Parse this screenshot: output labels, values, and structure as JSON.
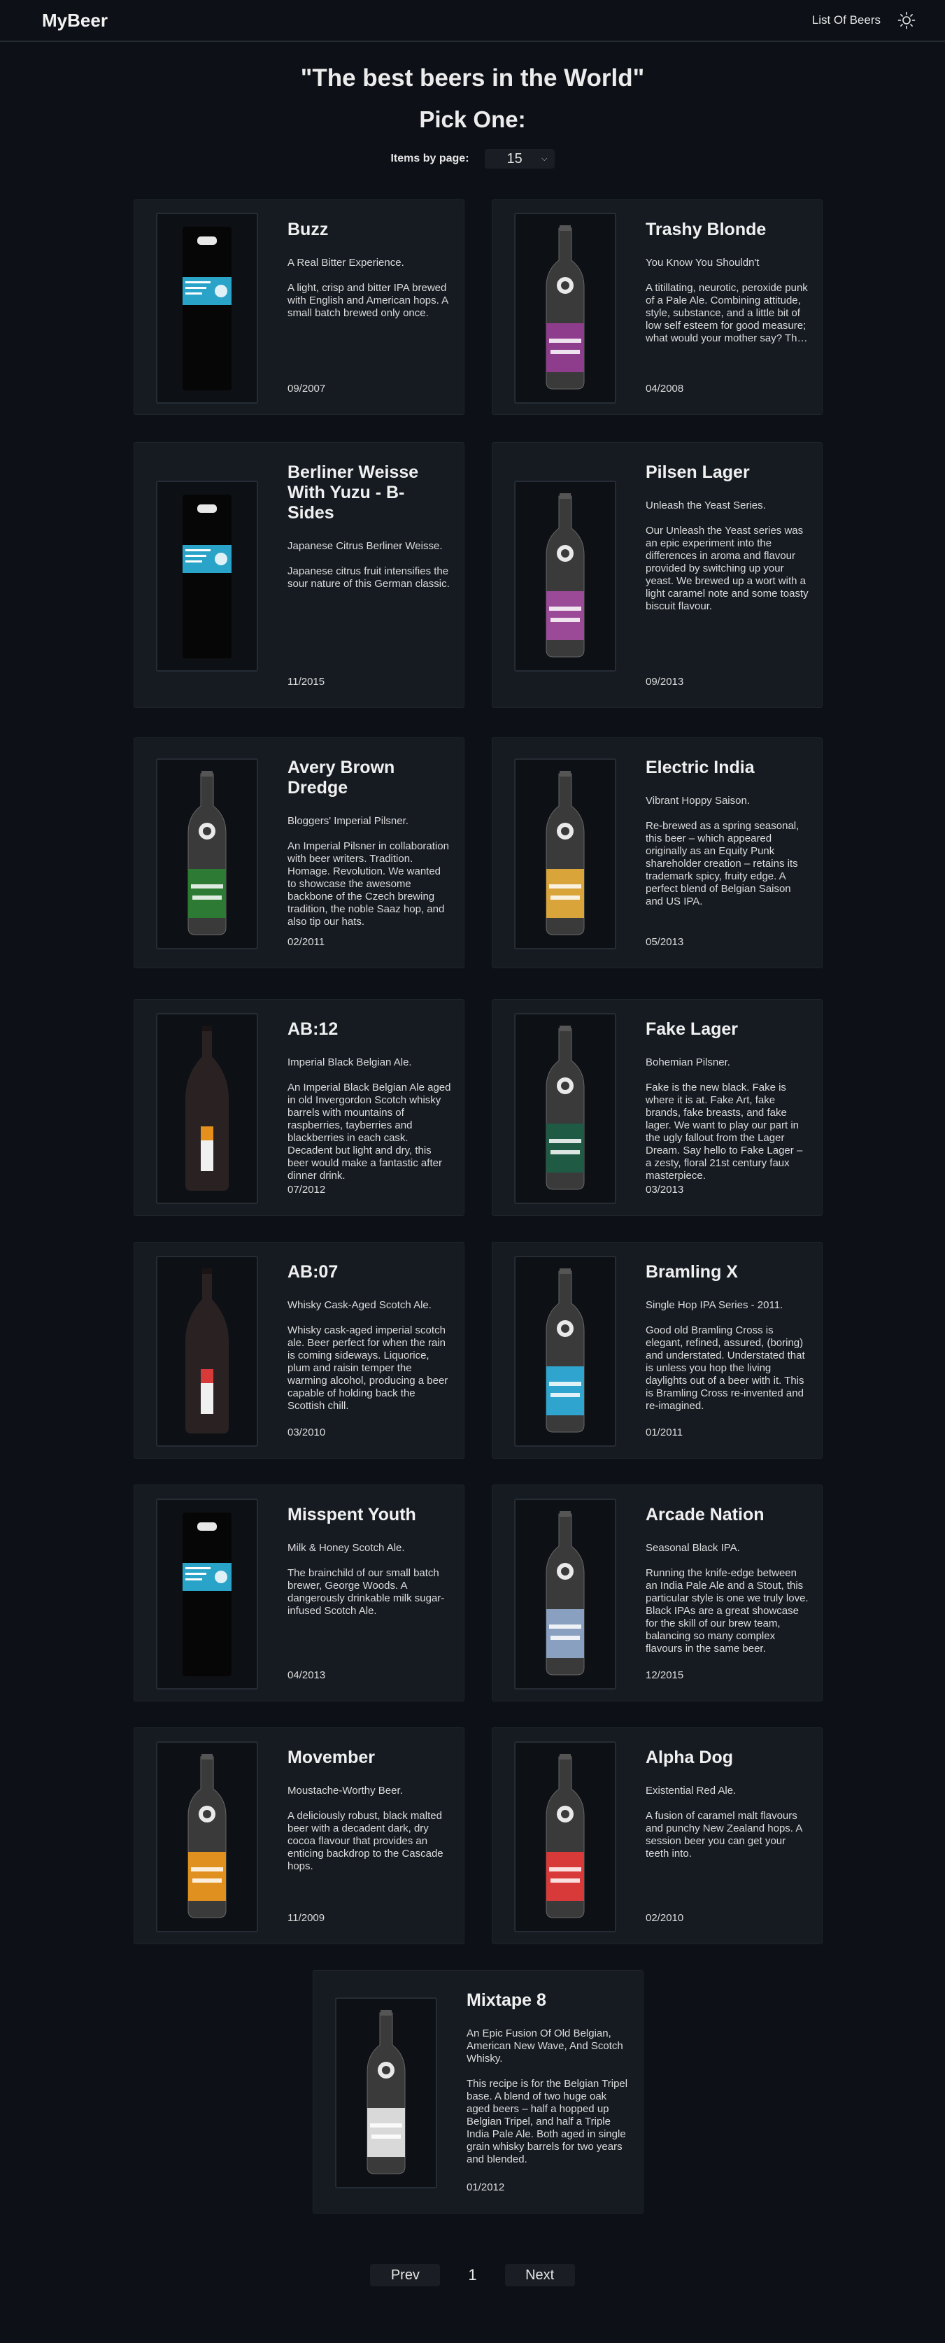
{
  "nav": {
    "brand": "MyBeer",
    "list_link": "List Of Beers",
    "theme_icon": "sun-icon"
  },
  "header": {
    "headline": "\"The best beers in the World\"",
    "subheadline": "Pick One:"
  },
  "controls": {
    "per_page_label": "Items by page:",
    "per_page_value": "15"
  },
  "beers": [
    {
      "name": "Buzz",
      "tagline": "A Real Bitter Experience.",
      "description": "A light, crisp and bitter IPA brewed with English and American hops. A small batch brewed only once.",
      "date": "09/2007",
      "label_color": "#2aa3c8",
      "bottle": "can"
    },
    {
      "name": "Trashy Blonde",
      "tagline": "You Know You Shouldn't",
      "description": "A titillating, neurotic, peroxide punk of a Pale Ale. Combining attitude, style, substance, and a little bit of low self esteem for good measure; what would your mother say? The seductive lure of the sassy passion fruit hop proves too much to resist.",
      "date": "04/2008",
      "label_color": "#8e3d8c",
      "bottle": "bottle"
    },
    {
      "name": "Berliner Weisse With Yuzu - B-Sides",
      "tagline": "Japanese Citrus Berliner Weisse.",
      "description": "Japanese citrus fruit intensifies the sour nature of this German classic.",
      "date": "11/2015",
      "label_color": "#2aa3c8",
      "bottle": "can"
    },
    {
      "name": "Pilsen Lager",
      "tagline": "Unleash the Yeast Series.",
      "description": "Our Unleash the Yeast series was an epic experiment into the differences in aroma and flavour provided by switching up your yeast. We brewed up a wort with a light caramel note and some toasty biscuit flavour.",
      "date": "09/2013",
      "label_color": "#9a4a96",
      "bottle": "bottle"
    },
    {
      "name": "Avery Brown Dredge",
      "tagline": "Bloggers' Imperial Pilsner.",
      "description": "An Imperial Pilsner in collaboration with beer writers. Tradition. Homage. Revolution. We wanted to showcase the awesome backbone of the Czech brewing tradition, the noble Saaz hop, and also tip our hats.",
      "date": "02/2011",
      "label_color": "#2d7a34",
      "bottle": "bottle"
    },
    {
      "name": "Electric India",
      "tagline": "Vibrant Hoppy Saison.",
      "description": "Re-brewed as a spring seasonal, this beer – which appeared originally as an Equity Punk shareholder creation – retains its trademark spicy, fruity edge. A perfect blend of Belgian Saison and US IPA.",
      "date": "05/2013",
      "label_color": "#d9a43a",
      "bottle": "bottle"
    },
    {
      "name": "AB:12",
      "tagline": "Imperial Black Belgian Ale.",
      "description": "An Imperial Black Belgian Ale aged in old Invergordon Scotch whisky barrels with mountains of raspberries, tayberries and blackberries in each cask. Decadent but light and dry, this beer would make a fantastic after dinner drink.",
      "date": "07/2012",
      "label_color": "#e58f1d",
      "bottle": "dark"
    },
    {
      "name": "Fake Lager",
      "tagline": "Bohemian Pilsner.",
      "description": "Fake is the new black. Fake is where it is at. Fake Art, fake brands, fake breasts, and fake lager. We want to play our part in the ugly fallout from the Lager Dream. Say hello to Fake Lager – a zesty, floral 21st century faux masterpiece.",
      "date": "03/2013",
      "label_color": "#1f5a45",
      "bottle": "bottle"
    },
    {
      "name": "AB:07",
      "tagline": "Whisky Cask-Aged Scotch Ale.",
      "description": "Whisky cask-aged imperial scotch ale. Beer perfect for when the rain is coming sideways. Liquorice, plum and raisin temper the warming alcohol, producing a beer capable of holding back the Scottish chill.",
      "date": "03/2010",
      "label_color": "#d83a3a",
      "bottle": "dark"
    },
    {
      "name": "Bramling X",
      "tagline": "Single Hop IPA Series - 2011.",
      "description": "Good old Bramling Cross is elegant, refined, assured, (boring) and understated. Understated that is unless you hop the living daylights out of a beer with it. This is Bramling Cross re-invented and re-imagined.",
      "date": "01/2011",
      "label_color": "#2ea4cf",
      "bottle": "bottle"
    },
    {
      "name": "Misspent Youth",
      "tagline": "Milk & Honey Scotch Ale.",
      "description": "The brainchild of our small batch brewer, George Woods. A dangerously drinkable milk sugar- infused Scotch Ale.",
      "date": "04/2013",
      "label_color": "#2aa3c8",
      "bottle": "can"
    },
    {
      "name": "Arcade Nation",
      "tagline": "Seasonal Black IPA.",
      "description": "Running the knife-edge between an India Pale Ale and a Stout, this particular style is one we truly love. Black IPAs are a great showcase for the skill of our brew team, balancing so many complex flavours in the same beer.",
      "date": "12/2015",
      "label_color": "#8aa0c0",
      "bottle": "bottle"
    },
    {
      "name": "Movember",
      "tagline": "Moustache-Worthy Beer.",
      "description": "A deliciously robust, black malted beer with a decadent dark, dry cocoa flavour that provides an enticing backdrop to the Cascade hops.",
      "date": "11/2009",
      "label_color": "#e0901e",
      "bottle": "bottle"
    },
    {
      "name": "Alpha Dog",
      "tagline": "Existential Red Ale.",
      "description": "A fusion of caramel malt flavours and punchy New Zealand hops. A session beer you can get your teeth into.",
      "date": "02/2010",
      "label_color": "#d83a3a",
      "bottle": "bottle"
    },
    {
      "name": "Mixtape 8",
      "tagline": "An Epic Fusion Of Old Belgian, American New Wave, And Scotch Whisky.",
      "description": "This recipe is for the Belgian Tripel base. A blend of two huge oak aged beers – half a hopped up Belgian Tripel, and half a Triple India Pale Ale. Both aged in single grain whisky barrels for two years and blended.",
      "date": "01/2012",
      "label_color": "#d9d9d9",
      "bottle": "bottle"
    }
  ],
  "pagination": {
    "prev": "Prev",
    "page": "1",
    "next": "Next"
  }
}
